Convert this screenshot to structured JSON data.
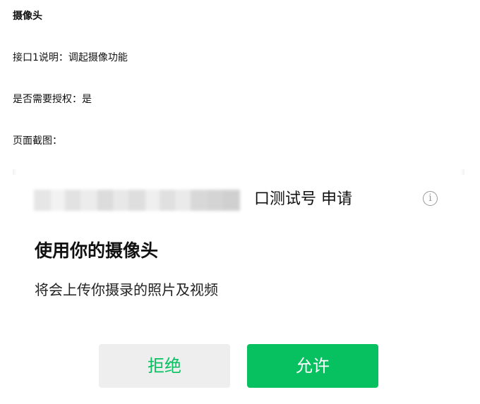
{
  "document": {
    "section_title": "摄像头",
    "interface_desc": "接口1说明：调起摄像功能",
    "needs_auth": "是否需要授权：是",
    "screenshot_label": "页面截图："
  },
  "dialog": {
    "applicant_suffix": "口测试号 申请",
    "title": "使用你的摄像头",
    "description": "将会上传你摄录的照片及视频",
    "deny_label": "拒绝",
    "allow_label": "允许"
  },
  "colors": {
    "accent_green": "#07c160",
    "deny_bg": "#eeeeee",
    "icon_gray": "#9a9a9a"
  },
  "icons": {
    "info": "info-icon"
  }
}
